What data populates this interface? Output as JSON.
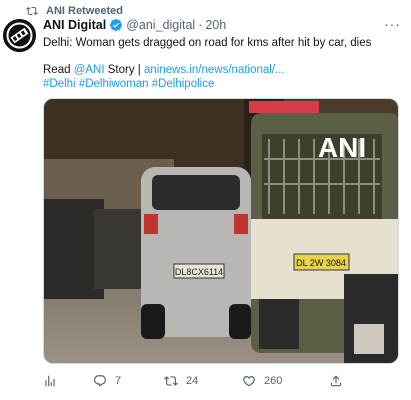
{
  "retweet": {
    "label": "ANI Retweeted"
  },
  "tweet": {
    "author_name": "ANI Digital",
    "handle": "@ani_digital",
    "separator": "·",
    "time": "20h",
    "text_line1": "Delhi: Woman gets dragged on road for kms after hit by car, dies",
    "read_prefix": "Read ",
    "read_mention": "@ANI",
    "read_story": " Story | ",
    "read_link": "aninews.in/news/national/...",
    "hashtags": [
      "#Delhi",
      "#Delhiwoman",
      "#Delhipolice"
    ]
  },
  "media": {
    "watermark": "ANI",
    "plate_car": "DL8CX6114",
    "plate_auto": "DL 2W 3084"
  },
  "actions": {
    "views": "",
    "replies": "7",
    "retweets": "24",
    "likes": "260"
  },
  "icons": {
    "retweet": "retweet-icon",
    "verified": "verified-badge-icon",
    "more": "more-icon",
    "analytics": "analytics-icon",
    "reply": "reply-icon",
    "like": "heart-icon",
    "share": "share-icon"
  },
  "colors": {
    "link": "#1d9bf0",
    "verified": "#1d9bf0",
    "muted": "#536471"
  }
}
